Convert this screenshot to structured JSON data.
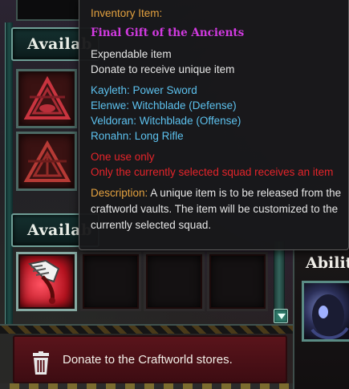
{
  "background": {
    "available_header_top": "Availab",
    "available_header_bottom": "Availab",
    "abilities_label": "Abilit",
    "donate_label": "Donate to the Craftworld stores."
  },
  "tooltip": {
    "category": "Inventory Item:",
    "item_name": "Final Gift of the Ancients",
    "type": "Expendable item",
    "effect": "Donate to receive unique item",
    "rewards": [
      "Kayleth: Power Sword",
      "Elenwe: Witchblade (Defense)",
      "Veldoran: Witchblade (Offense)",
      "Ronahn: Long Rifle"
    ],
    "warning_1": "One use only",
    "warning_2": "Only the currently selected squad receives an item",
    "description_label": "Description:",
    "description_text": "A unique item is to be released from the craftworld vaults. The item will be customized to the currently selected squad."
  },
  "colors": {
    "category": "#e3a13f",
    "item_name": "#d13ae0",
    "rewards": "#5dc2ef",
    "warnings": "#e5242a"
  },
  "icons": {
    "slot_top": "eldar-rune-icon",
    "slot_second": "eldar-rune-icon",
    "equipped_item": "power-glove-icon",
    "donate": "trash-bin-icon",
    "scroll": "chevron-down-icon"
  }
}
